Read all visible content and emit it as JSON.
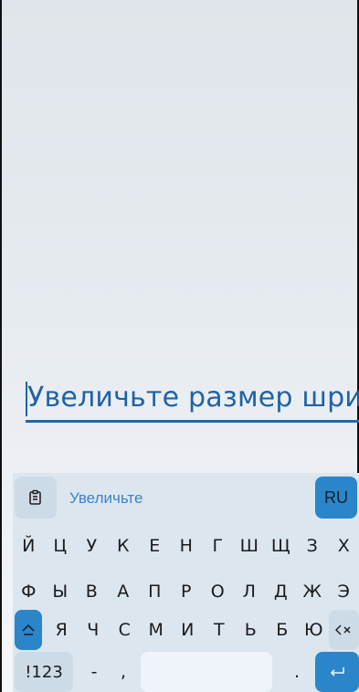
{
  "text_field": {
    "value": "Увеличьте размер шри"
  },
  "keyboard": {
    "clipboard_icon": "clipboard-icon",
    "suggestion": "Увеличьте",
    "language": "RU",
    "row1": [
      "й",
      "ц",
      "у",
      "к",
      "е",
      "н",
      "г",
      "ш",
      "щ",
      "з",
      "х"
    ],
    "row2": [
      "ф",
      "ы",
      "в",
      "а",
      "п",
      "р",
      "о",
      "л",
      "д",
      "ж",
      "э"
    ],
    "row3": [
      "я",
      "ч",
      "с",
      "м",
      "и",
      "т",
      "ь",
      "б",
      "ю"
    ],
    "shift_icon": "shift-icon",
    "backspace_icon": "backspace-icon",
    "symbols_label": "!123",
    "dash": "-",
    "comma": ",",
    "period": ".",
    "enter_icon": "enter-icon"
  },
  "colors": {
    "accent": "#2a86c9",
    "text_blue": "#1e63a6",
    "keyboard_bg": "#dbe6ef"
  }
}
